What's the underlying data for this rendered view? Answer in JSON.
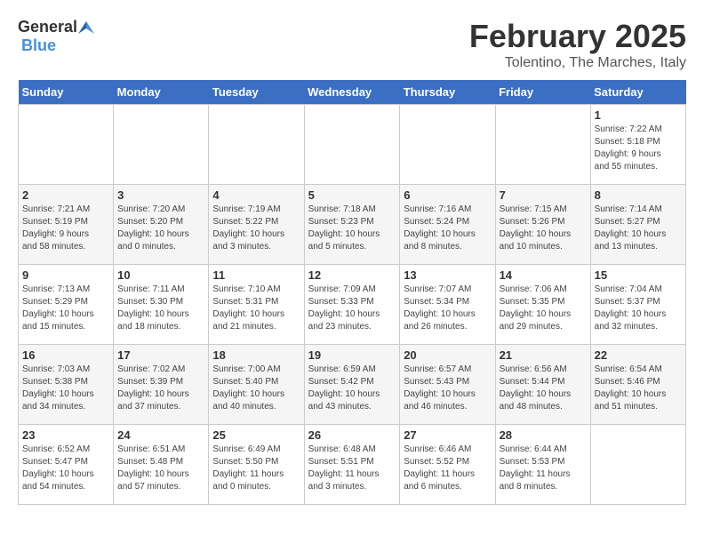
{
  "header": {
    "logo_general": "General",
    "logo_blue": "Blue",
    "title": "February 2025",
    "location": "Tolentino, The Marches, Italy"
  },
  "weekdays": [
    "Sunday",
    "Monday",
    "Tuesday",
    "Wednesday",
    "Thursday",
    "Friday",
    "Saturday"
  ],
  "weeks": [
    [
      {
        "day": "",
        "info": ""
      },
      {
        "day": "",
        "info": ""
      },
      {
        "day": "",
        "info": ""
      },
      {
        "day": "",
        "info": ""
      },
      {
        "day": "",
        "info": ""
      },
      {
        "day": "",
        "info": ""
      },
      {
        "day": "1",
        "info": "Sunrise: 7:22 AM\nSunset: 5:18 PM\nDaylight: 9 hours\nand 55 minutes."
      }
    ],
    [
      {
        "day": "2",
        "info": "Sunrise: 7:21 AM\nSunset: 5:19 PM\nDaylight: 9 hours\nand 58 minutes."
      },
      {
        "day": "3",
        "info": "Sunrise: 7:20 AM\nSunset: 5:20 PM\nDaylight: 10 hours\nand 0 minutes."
      },
      {
        "day": "4",
        "info": "Sunrise: 7:19 AM\nSunset: 5:22 PM\nDaylight: 10 hours\nand 3 minutes."
      },
      {
        "day": "5",
        "info": "Sunrise: 7:18 AM\nSunset: 5:23 PM\nDaylight: 10 hours\nand 5 minutes."
      },
      {
        "day": "6",
        "info": "Sunrise: 7:16 AM\nSunset: 5:24 PM\nDaylight: 10 hours\nand 8 minutes."
      },
      {
        "day": "7",
        "info": "Sunrise: 7:15 AM\nSunset: 5:26 PM\nDaylight: 10 hours\nand 10 minutes."
      },
      {
        "day": "8",
        "info": "Sunrise: 7:14 AM\nSunset: 5:27 PM\nDaylight: 10 hours\nand 13 minutes."
      }
    ],
    [
      {
        "day": "9",
        "info": "Sunrise: 7:13 AM\nSunset: 5:29 PM\nDaylight: 10 hours\nand 15 minutes."
      },
      {
        "day": "10",
        "info": "Sunrise: 7:11 AM\nSunset: 5:30 PM\nDaylight: 10 hours\nand 18 minutes."
      },
      {
        "day": "11",
        "info": "Sunrise: 7:10 AM\nSunset: 5:31 PM\nDaylight: 10 hours\nand 21 minutes."
      },
      {
        "day": "12",
        "info": "Sunrise: 7:09 AM\nSunset: 5:33 PM\nDaylight: 10 hours\nand 23 minutes."
      },
      {
        "day": "13",
        "info": "Sunrise: 7:07 AM\nSunset: 5:34 PM\nDaylight: 10 hours\nand 26 minutes."
      },
      {
        "day": "14",
        "info": "Sunrise: 7:06 AM\nSunset: 5:35 PM\nDaylight: 10 hours\nand 29 minutes."
      },
      {
        "day": "15",
        "info": "Sunrise: 7:04 AM\nSunset: 5:37 PM\nDaylight: 10 hours\nand 32 minutes."
      }
    ],
    [
      {
        "day": "16",
        "info": "Sunrise: 7:03 AM\nSunset: 5:38 PM\nDaylight: 10 hours\nand 34 minutes."
      },
      {
        "day": "17",
        "info": "Sunrise: 7:02 AM\nSunset: 5:39 PM\nDaylight: 10 hours\nand 37 minutes."
      },
      {
        "day": "18",
        "info": "Sunrise: 7:00 AM\nSunset: 5:40 PM\nDaylight: 10 hours\nand 40 minutes."
      },
      {
        "day": "19",
        "info": "Sunrise: 6:59 AM\nSunset: 5:42 PM\nDaylight: 10 hours\nand 43 minutes."
      },
      {
        "day": "20",
        "info": "Sunrise: 6:57 AM\nSunset: 5:43 PM\nDaylight: 10 hours\nand 46 minutes."
      },
      {
        "day": "21",
        "info": "Sunrise: 6:56 AM\nSunset: 5:44 PM\nDaylight: 10 hours\nand 48 minutes."
      },
      {
        "day": "22",
        "info": "Sunrise: 6:54 AM\nSunset: 5:46 PM\nDaylight: 10 hours\nand 51 minutes."
      }
    ],
    [
      {
        "day": "23",
        "info": "Sunrise: 6:52 AM\nSunset: 5:47 PM\nDaylight: 10 hours\nand 54 minutes."
      },
      {
        "day": "24",
        "info": "Sunrise: 6:51 AM\nSunset: 5:48 PM\nDaylight: 10 hours\nand 57 minutes."
      },
      {
        "day": "25",
        "info": "Sunrise: 6:49 AM\nSunset: 5:50 PM\nDaylight: 11 hours\nand 0 minutes."
      },
      {
        "day": "26",
        "info": "Sunrise: 6:48 AM\nSunset: 5:51 PM\nDaylight: 11 hours\nand 3 minutes."
      },
      {
        "day": "27",
        "info": "Sunrise: 6:46 AM\nSunset: 5:52 PM\nDaylight: 11 hours\nand 6 minutes."
      },
      {
        "day": "28",
        "info": "Sunrise: 6:44 AM\nSunset: 5:53 PM\nDaylight: 11 hours\nand 8 minutes."
      },
      {
        "day": "",
        "info": ""
      }
    ]
  ]
}
